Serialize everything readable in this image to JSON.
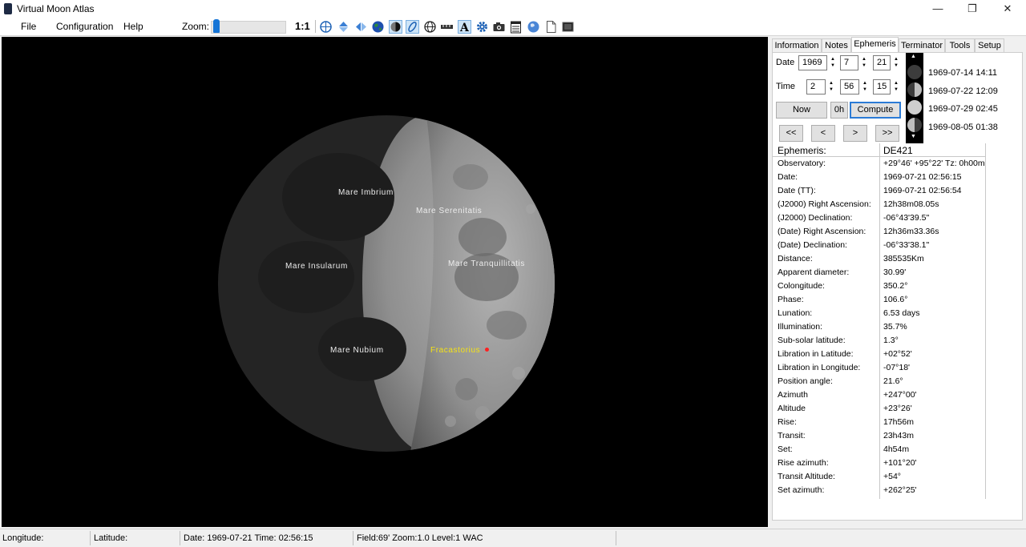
{
  "window": {
    "title": "Virtual Moon Atlas",
    "minimize_glyph": "—",
    "restore_glyph": "❐",
    "close_glyph": "✕"
  },
  "menu": {
    "items": [
      "File",
      "Configuration",
      "Help"
    ]
  },
  "toolbar": {
    "zoom_label": "Zoom:",
    "zoom_level": 0.05,
    "ratio_label": "1:1",
    "icons": [
      "grid-globe-icon",
      "flip-vertical-icon",
      "flip-horizontal-icon",
      "earth-icon",
      "moon-phase-icon",
      "libration-icon",
      "globe-grid-icon",
      "scale-bar-icon",
      "labels-icon",
      "settings-gear-icon",
      "camera-icon",
      "calendar-icon",
      "earth-view-icon",
      "document-icon",
      "dark-display-icon"
    ],
    "accent": "#1574d6"
  },
  "map": {
    "labels": {
      "imbrium": "Mare Imbrium",
      "serenitatis": "Mare Serenitatis",
      "insularum": "Mare Insularum",
      "tranquillitatis": "Mare Tranquillitatis",
      "nubium": "Mare Nubium",
      "fracastorius": "Fracastorius"
    },
    "highlight_color": "#f5e316",
    "marker_color": "#ff2020"
  },
  "tabs": [
    "Information",
    "Notes",
    "Ephemeris",
    "Terminator",
    "Tools",
    "Setup"
  ],
  "ephemeris": {
    "date_label": "Date",
    "time_label": "Time",
    "year": "1969",
    "month": "7",
    "day": "21",
    "hour": "2",
    "minute": "56",
    "second": "15",
    "now_label": "Now",
    "zero_h_label": "0h",
    "compute_label": "Compute",
    "nav": {
      "first": "<<",
      "prev": "<",
      "next": ">",
      "last": ">>"
    },
    "phase_dates": [
      "1969-07-14 14:11",
      "1969-07-22 12:09",
      "1969-07-29 02:45",
      "1969-08-05 01:38"
    ],
    "header_key": "Ephemeris:",
    "header_value": "DE421",
    "rows": [
      {
        "k": "Observatory:",
        "v": "+29°46' +95°22' Tz:  0h00m"
      },
      {
        "k": "Date:",
        "v": "1969-07-21 02:56:15"
      },
      {
        "k": "Date (TT):",
        "v": "1969-07-21 02:56:54"
      },
      {
        "k": "(J2000) Right Ascension:",
        "v": " 12h38m08.05s"
      },
      {
        "k": "(J2000) Declination:",
        "v": "-06°43'39.5\""
      },
      {
        "k": "(Date) Right Ascension:",
        "v": " 12h36m33.36s"
      },
      {
        "k": "(Date) Declination:",
        "v": "-06°33'38.1\""
      },
      {
        "k": "Distance:",
        "v": "385535Km"
      },
      {
        "k": "Apparent diameter:",
        "v": "30.99'"
      },
      {
        "k": "Colongitude:",
        "v": "350.2°"
      },
      {
        "k": "Phase:",
        "v": "106.6°"
      },
      {
        "k": "Lunation:",
        "v": "6.53 days"
      },
      {
        "k": "Illumination:",
        "v": "35.7%"
      },
      {
        "k": "Sub-solar latitude:",
        "v": "1.3°"
      },
      {
        "k": "Libration in Latitude:",
        "v": "+02°52'"
      },
      {
        "k": "Libration in Longitude:",
        "v": "-07°18'"
      },
      {
        "k": "Position angle:",
        "v": "21.6°"
      },
      {
        "k": "Azimuth",
        "v": "+247°00'"
      },
      {
        "k": "Altitude",
        "v": "+23°26'"
      },
      {
        "k": "Rise:",
        "v": " 17h56m"
      },
      {
        "k": "Transit:",
        "v": " 23h43m"
      },
      {
        "k": "Set:",
        "v": "  4h54m"
      },
      {
        "k": "Rise azimuth:",
        "v": "+101°20'"
      },
      {
        "k": "Transit Altitude:",
        "v": "+54°"
      },
      {
        "k": "Set azimuth:",
        "v": "+262°25'"
      }
    ]
  },
  "status": {
    "longitude": "Longitude:",
    "latitude": "Latitude:",
    "datetime": "Date: 1969-07-21   Time: 02:56:15",
    "field": "Field:69' Zoom:1.0  Level:1 WAC"
  }
}
